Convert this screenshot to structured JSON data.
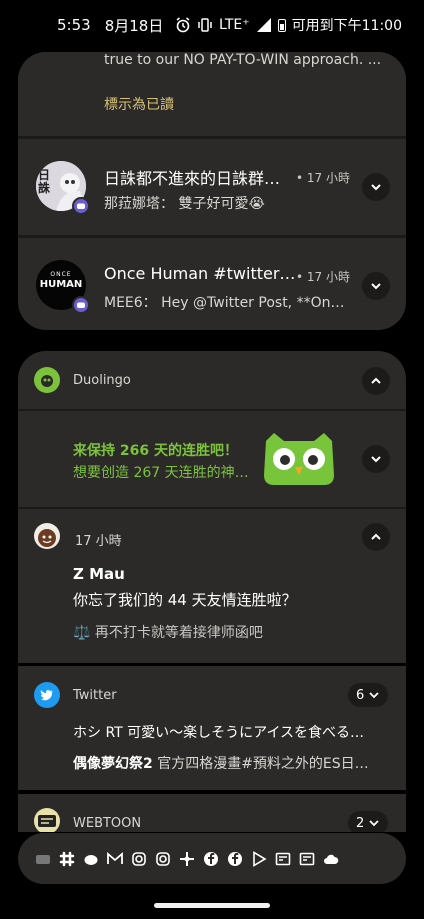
{
  "status_bar": {
    "time": "5:53",
    "date": "8月18日",
    "network": "LTE⁺",
    "charge_text": "可用到下午11:00"
  },
  "top_group": {
    "partial_text": "true to our NO PAY-TO-WIN approach. ...",
    "mark_read": "標示為已讀",
    "notifications": [
      {
        "title": "日誅都不進來的日誅群…",
        "time": "• 17 小時",
        "sender": "那菈娜塔：",
        "message": "雙子好可愛😭",
        "avatar_label": "日誅"
      },
      {
        "title": "Once Human #twitter…",
        "time": "• 17 小時",
        "sender": "MEE6：",
        "message": "Hey @Twitter Post, **On…",
        "avatar_label_top": "ONCE",
        "avatar_label_main": "HUMAN"
      }
    ]
  },
  "duolingo": {
    "app_name": "Duolingo",
    "streak_title": "来保持 266 天的连胜吧！",
    "streak_body": "想要创造 267 天连胜的神…",
    "friend_time": "17 小時",
    "friend_name": "Z Mau",
    "friend_message": "你忘了我们的 44 天友情连胜啦？",
    "friend_footer": "⚖️ 再不打卡就等着接律师函吧"
  },
  "twitter": {
    "app_name": "Twitter",
    "count": "6",
    "line1": "ホシ RT 可愛い～楽しそうにアイスを食べる…",
    "line2_bold": "偶像夢幻祭2",
    "line2": "官方四格漫畫#預料之外的ES日…"
  },
  "webtoon": {
    "app_name": "WEBTOON",
    "count": "2"
  },
  "dock": {
    "icons": [
      "collapsed-stack-icon",
      "slack-icon",
      "cloud-duck-icon",
      "gmail-icon",
      "instagram-icon",
      "instagram-icon",
      "pinwheel-icon",
      "facebook-icon",
      "facebook-icon",
      "play-store-icon",
      "news-icon",
      "news-icon",
      "cloud-icon"
    ]
  }
}
